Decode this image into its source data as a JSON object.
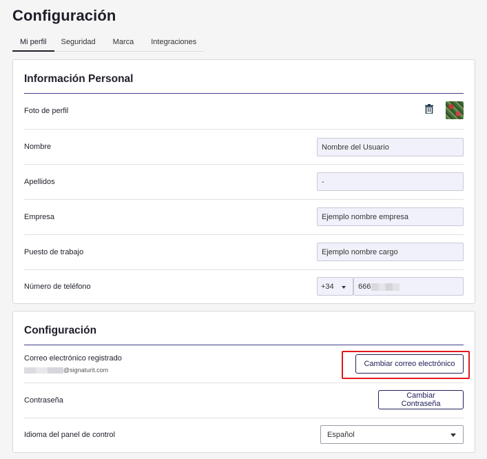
{
  "page": {
    "title": "Configuración"
  },
  "tabs": [
    {
      "label": "Mi perfil",
      "active": true
    },
    {
      "label": "Seguridad",
      "active": false
    },
    {
      "label": "Marca",
      "active": false
    },
    {
      "label": "Integraciones",
      "active": false
    }
  ],
  "personal": {
    "title": "Información Personal",
    "photo_label": "Foto de perfil",
    "first_name": {
      "label": "Nombre",
      "value": "Nombre del Usuario"
    },
    "last_name": {
      "label": "Apellidos",
      "value": "-"
    },
    "company": {
      "label": "Empresa",
      "value": "Ejemplo nombre empresa"
    },
    "job": {
      "label": "Puesto de trabajo",
      "value": "Ejemplo nombre cargo"
    },
    "phone": {
      "label": "Número de teléfono",
      "prefix": "+34",
      "number": "666"
    }
  },
  "config": {
    "title": "Configuración",
    "email_label": "Correo electrónico registrado",
    "email_domain": "@signaturit.com",
    "change_email_button": "Cambiar correo electrónico",
    "password_label": "Contraseña",
    "change_password_button": "Cambiar Contraseña",
    "language_label": "Idioma del panel de control",
    "language_value": "Español"
  },
  "colors": {
    "accent": "#20205a",
    "rule": "#3f3f8c",
    "highlight": "#e3161c",
    "input_bg": "#f1f1fb"
  }
}
